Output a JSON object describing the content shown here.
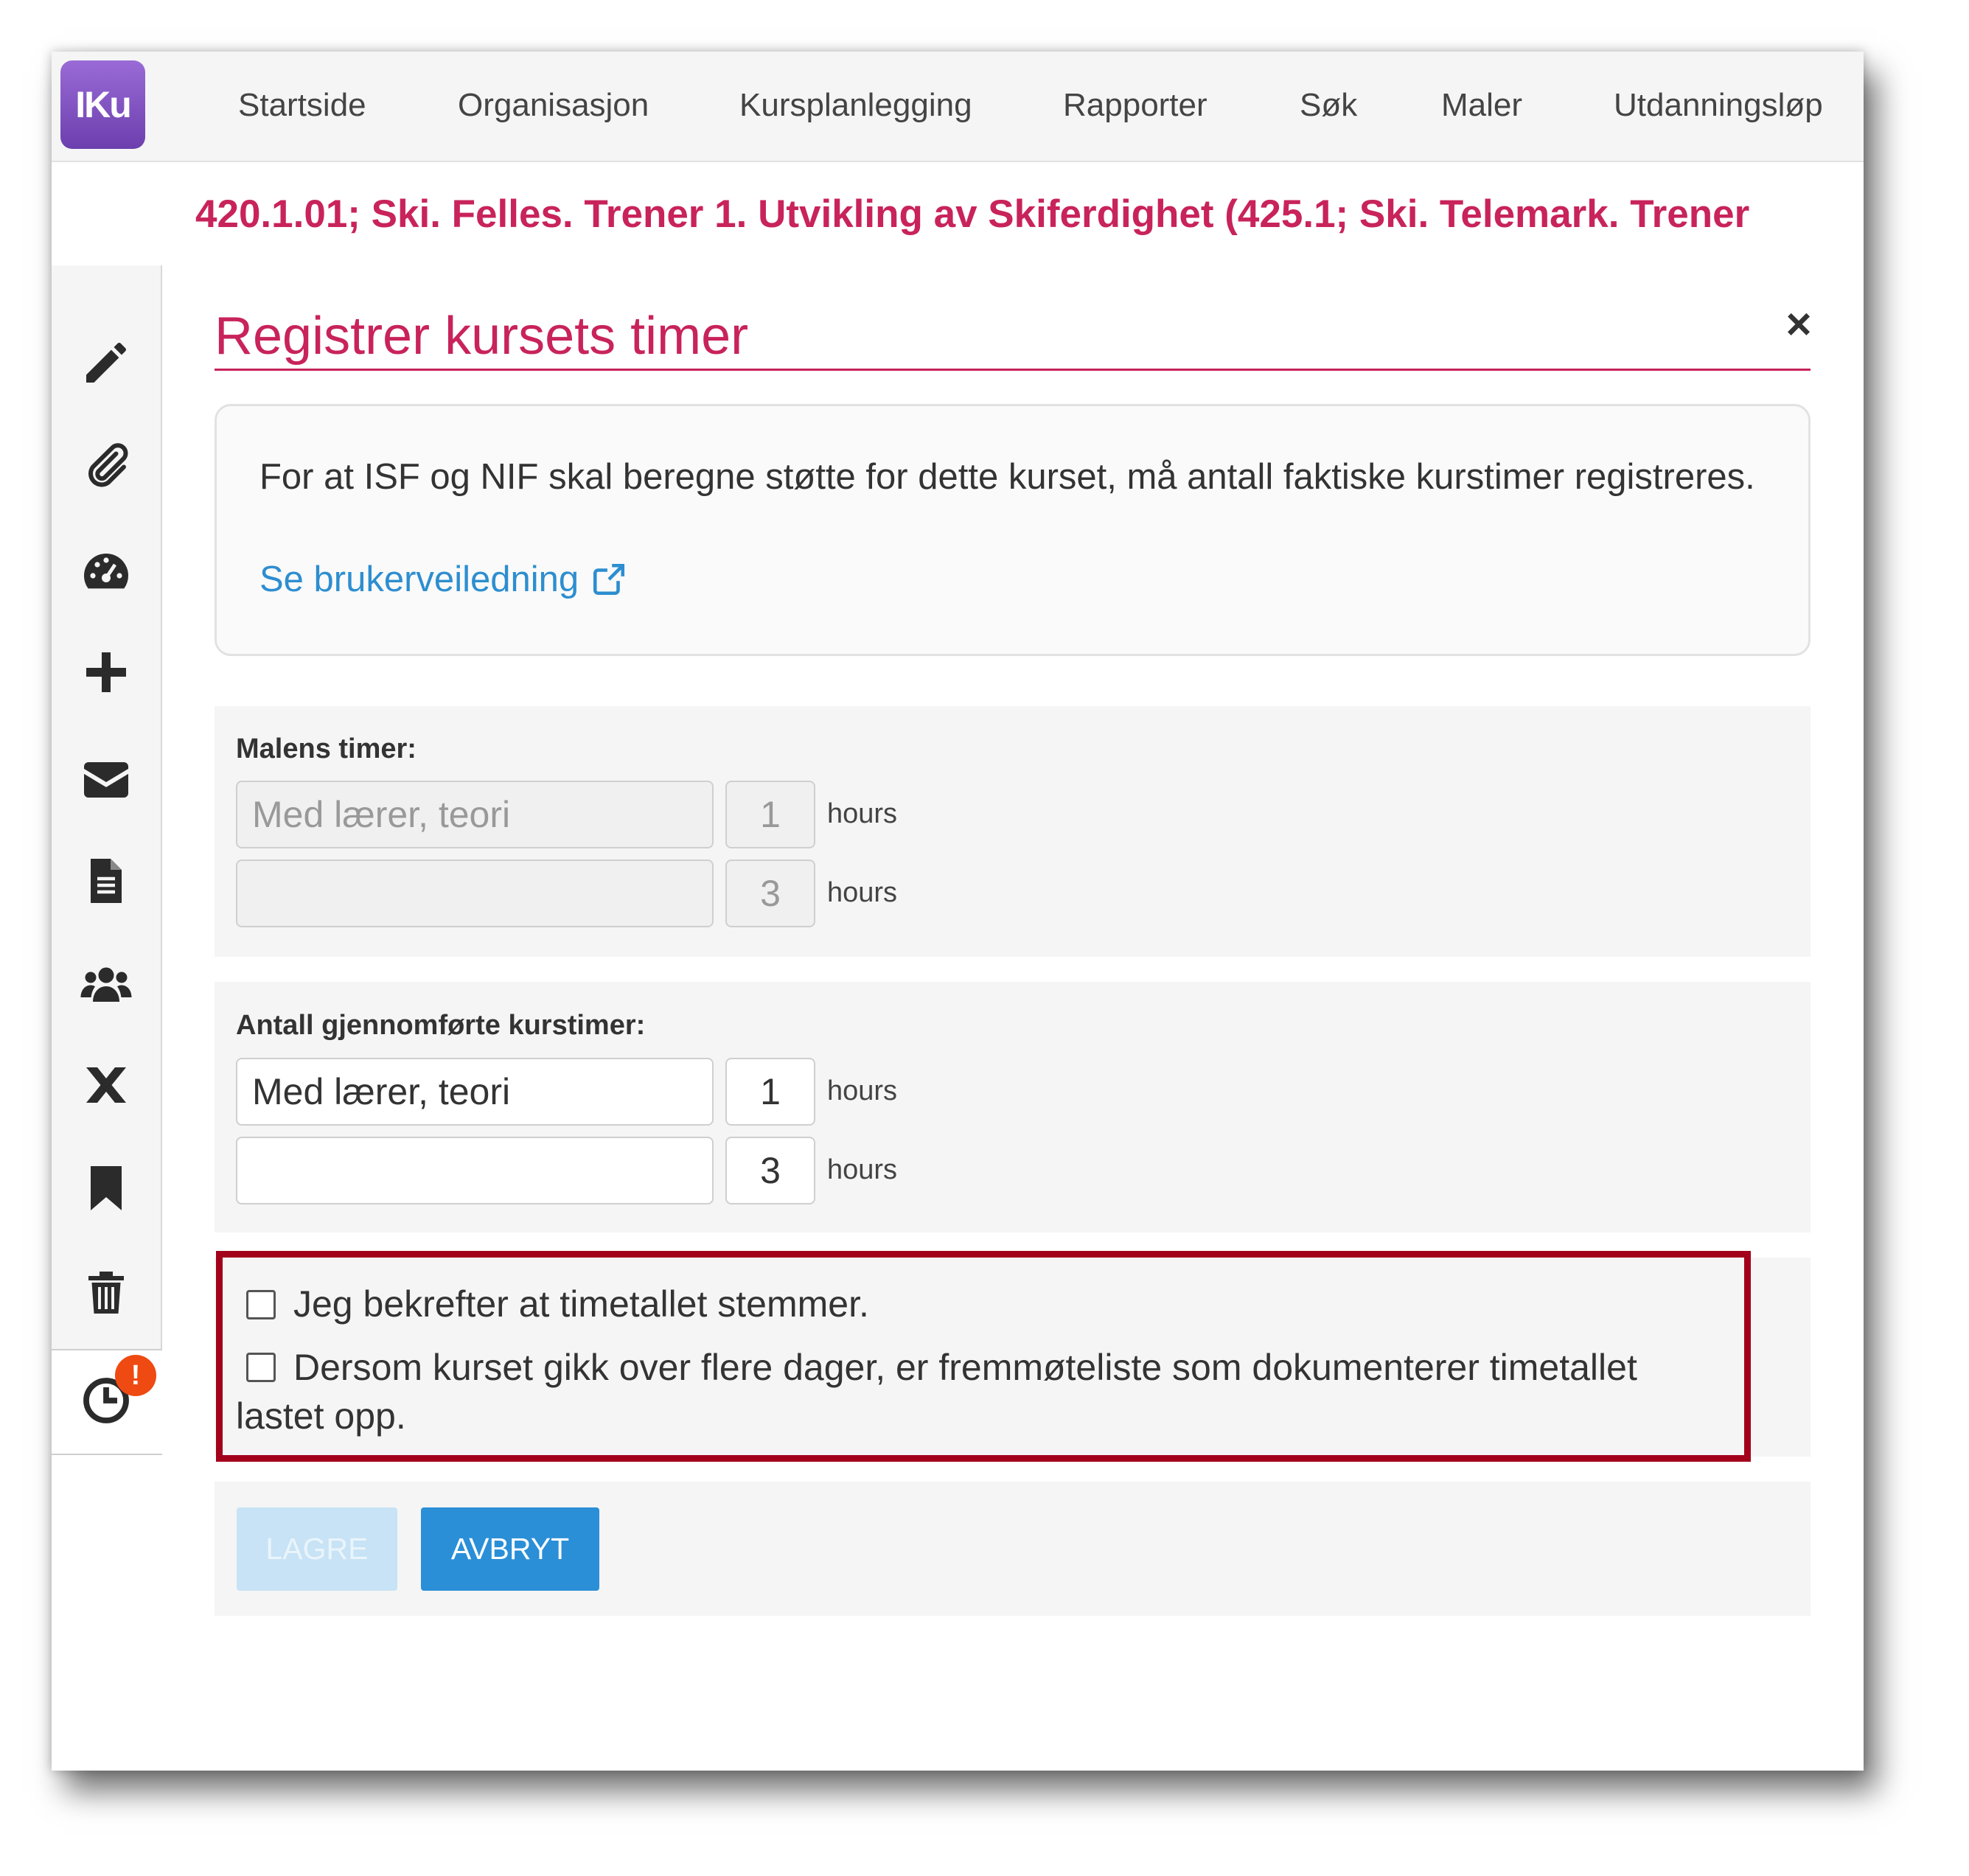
{
  "app": {
    "logo_text": "IKu"
  },
  "nav": {
    "items": [
      "Startside",
      "Organisasjon",
      "Kursplanlegging",
      "Rapporter",
      "Søk",
      "Maler",
      "Utdanningsløp"
    ]
  },
  "course": {
    "title": "420.1.01; Ski. Felles. Trener 1. Utvikling av Skiferdighet (425.1; Ski. Telemark. Trener"
  },
  "sidebar": {
    "icons": [
      "pencil-icon",
      "paperclip-icon",
      "dashboard-icon",
      "plus-icon",
      "envelope-icon",
      "document-icon",
      "users-icon",
      "cross-icon",
      "bookmark-icon",
      "trash-icon",
      "clock-icon"
    ],
    "badge": "!"
  },
  "panel": {
    "title": "Registrer kursets timer",
    "close": "×",
    "info_text": "For at ISF og NIF skal beregne støtte for dette kurset, må antall faktiske kurstimer registreres.",
    "info_link": "Se brukerveiledning"
  },
  "template_hours": {
    "label": "Malens timer:",
    "rows": [
      {
        "type": "Med lærer, teori",
        "hours": "1",
        "unit": "hours"
      },
      {
        "type": "",
        "hours": "3",
        "unit": "hours"
      }
    ]
  },
  "completed_hours": {
    "label": "Antall gjennomførte kurstimer:",
    "rows": [
      {
        "type": "Med lærer, teori",
        "hours": "1",
        "unit": "hours"
      },
      {
        "type": "",
        "hours": "3",
        "unit": "hours"
      }
    ]
  },
  "confirm": {
    "check1": "Jeg bekrefter at timetallet stemmer.",
    "check2": "Dersom kurset gikk over flere dager, er fremmøteliste som dokumenterer timetallet lastet opp."
  },
  "buttons": {
    "save": "LAGRE",
    "cancel": "AVBRYT"
  },
  "colors": {
    "accent": "#c8235a",
    "primary": "#2a8fd7",
    "highlight": "#a3001b",
    "badge": "#ee4a12"
  }
}
